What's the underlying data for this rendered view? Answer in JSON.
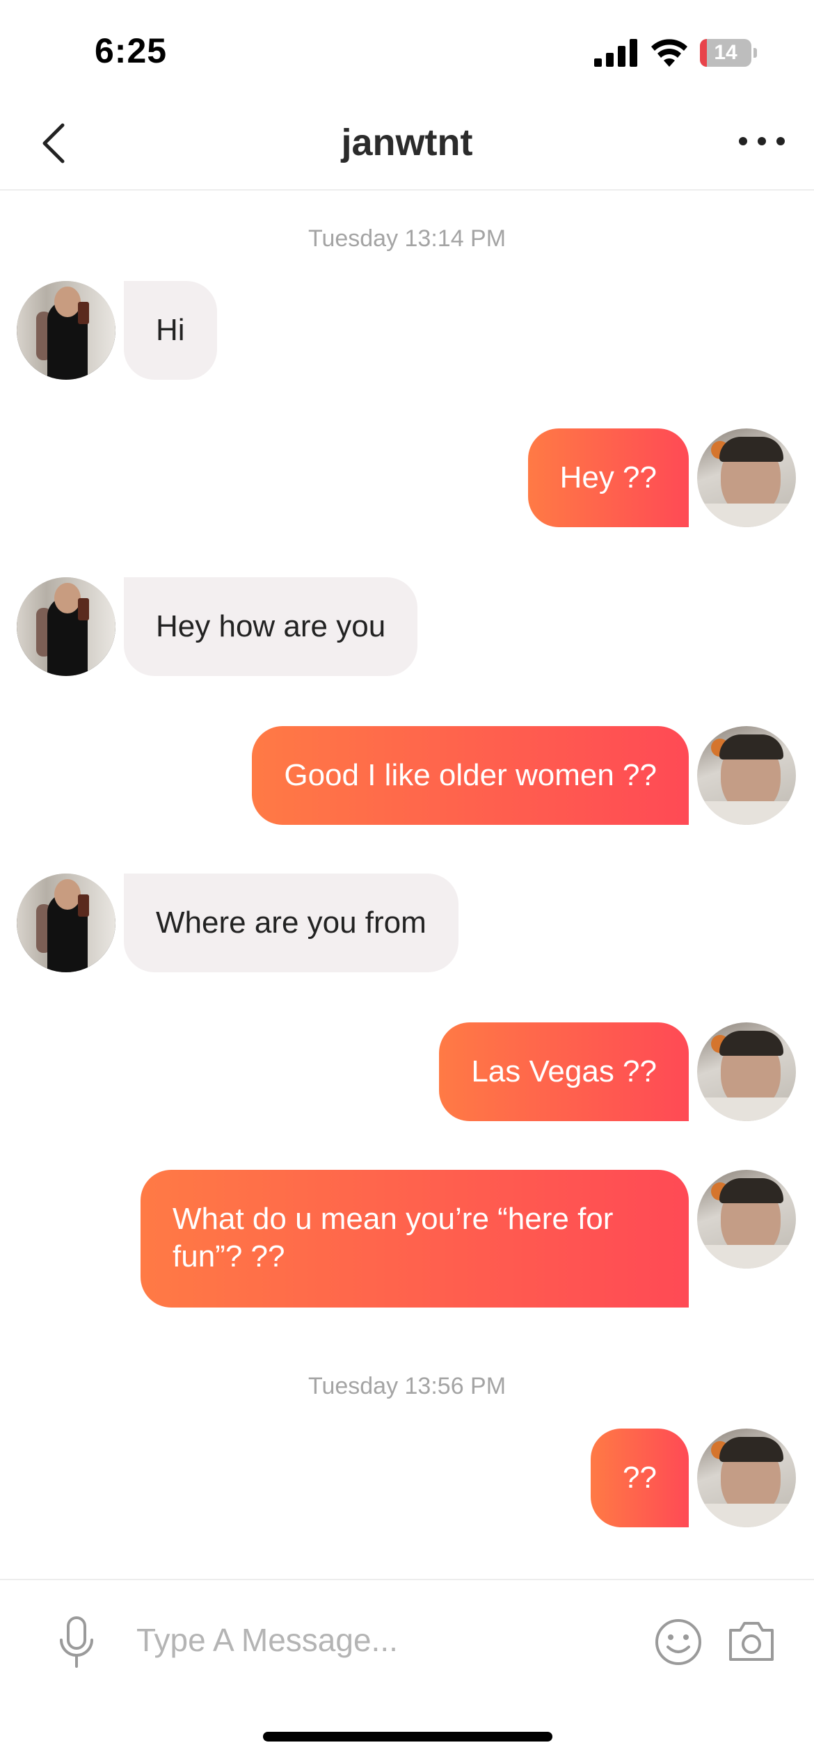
{
  "status_bar": {
    "time": "6:25",
    "battery_level": "14",
    "battery_fraction": 0.14
  },
  "header": {
    "title": "janwtnt"
  },
  "conversation": [
    {
      "type": "timestamp",
      "text": "Tuesday 13:14 PM"
    },
    {
      "type": "incoming",
      "text": "Hi"
    },
    {
      "type": "outgoing",
      "text": "Hey ??"
    },
    {
      "type": "incoming",
      "text": "Hey how are you"
    },
    {
      "type": "outgoing",
      "text": "Good I like older women ??"
    },
    {
      "type": "incoming",
      "text": "Where are you from"
    },
    {
      "type": "outgoing",
      "text": "Las Vegas ??"
    },
    {
      "type": "outgoing",
      "text": "What do u mean you’re “here for fun”? ??"
    },
    {
      "type": "timestamp",
      "text": "Tuesday 13:56 PM"
    },
    {
      "type": "outgoing",
      "text": "??"
    }
  ],
  "composer": {
    "placeholder": "Type A Message...",
    "value": ""
  },
  "colors": {
    "outgoing_gradient_start": "#ff7a45",
    "outgoing_gradient_end": "#ff4a55",
    "incoming_bubble": "#f3eff0",
    "timestamp_text": "#a4a4a4"
  },
  "icons": {
    "back": "chevron-left-icon",
    "more": "more-horizontal-icon",
    "mic": "microphone-icon",
    "emoji": "smiley-icon",
    "camera": "camera-icon"
  }
}
